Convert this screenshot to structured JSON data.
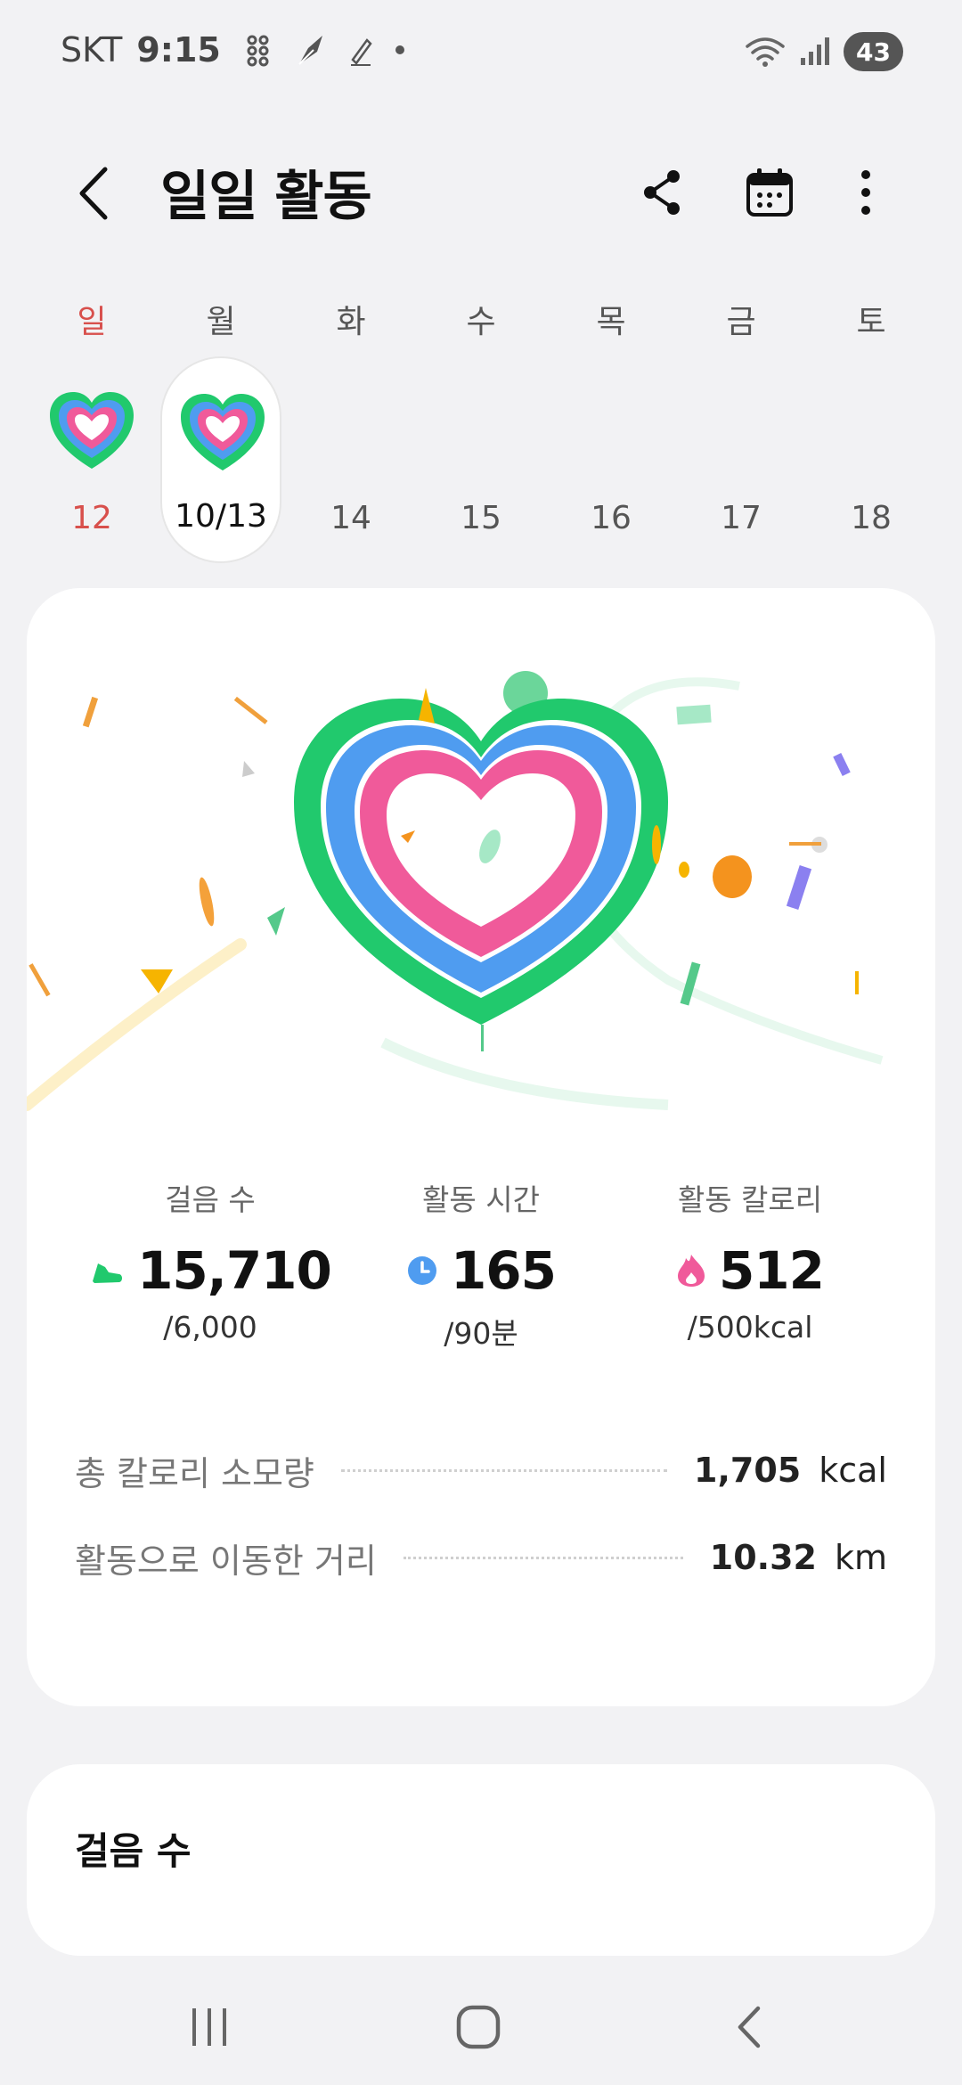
{
  "status_bar": {
    "carrier": "SKT",
    "time": "9:15",
    "battery": "43",
    "icons": [
      "grid-app-icon",
      "quill-icon",
      "pen-icon",
      "dot-icon",
      "wifi-icon",
      "signal-icon"
    ]
  },
  "header": {
    "title": "일일 활동",
    "icons": [
      "back-icon",
      "share-icon",
      "calendar-icon",
      "more-icon"
    ]
  },
  "week": {
    "days": [
      {
        "name": "일",
        "date": "12",
        "has_ring": true,
        "sunday": true,
        "selected": false
      },
      {
        "name": "월",
        "date": "10/13",
        "has_ring": true,
        "sunday": false,
        "selected": true
      },
      {
        "name": "화",
        "date": "14",
        "has_ring": false,
        "sunday": false,
        "selected": false
      },
      {
        "name": "수",
        "date": "15",
        "has_ring": false,
        "sunday": false,
        "selected": false
      },
      {
        "name": "목",
        "date": "16",
        "has_ring": false,
        "sunday": false,
        "selected": false
      },
      {
        "name": "금",
        "date": "17",
        "has_ring": false,
        "sunday": false,
        "selected": false
      },
      {
        "name": "토",
        "date": "18",
        "has_ring": false,
        "sunday": false,
        "selected": false
      }
    ]
  },
  "summary": {
    "steps": {
      "label": "걸음 수",
      "value": "15,710",
      "goal": "/6,000",
      "icon": "shoe-icon"
    },
    "active_time": {
      "label": "활동 시간",
      "value": "165",
      "goal": "/90분",
      "icon": "clock-icon"
    },
    "active_calories": {
      "label": "활동 칼로리",
      "value": "512",
      "goal": "/500kcal",
      "icon": "flame-icon"
    },
    "total_calories": {
      "label": "총 칼로리 소모량",
      "value": "1,705",
      "unit": "kcal"
    },
    "distance": {
      "label": "활동으로 이동한 거리",
      "value": "10.32",
      "unit": "km"
    }
  },
  "steps_card": {
    "title": "걸음 수"
  },
  "colors": {
    "ring_outer": "#21c96d",
    "ring_middle": "#4f9cf0",
    "ring_inner": "#f05a9a",
    "sunday": "#d8504c",
    "background": "#f2f2f4"
  },
  "nav": {
    "icons": [
      "recents-icon",
      "home-icon",
      "back-nav-icon"
    ]
  }
}
